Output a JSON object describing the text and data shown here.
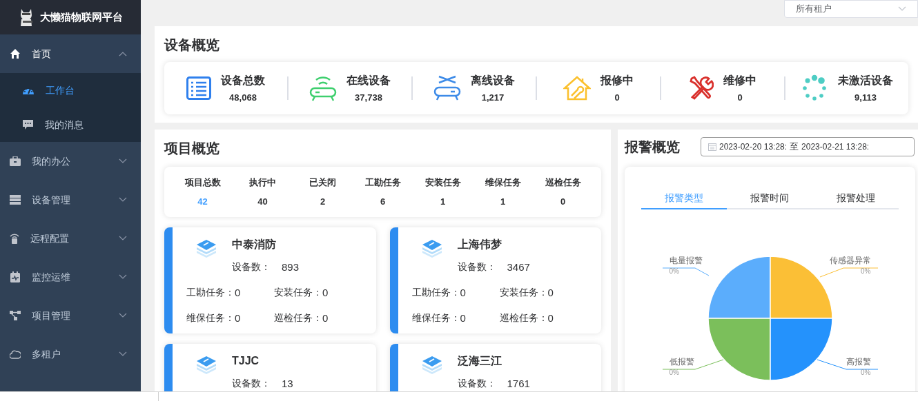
{
  "brand": {
    "title": "大懒猫物联网平台"
  },
  "sidebar": {
    "items": [
      {
        "label": "首页",
        "expanded": true,
        "children": [
          {
            "label": "工作台",
            "selected": true
          },
          {
            "label": "我的消息",
            "selected": false
          }
        ]
      },
      {
        "label": "我的办公",
        "expanded": false
      },
      {
        "label": "设备管理",
        "expanded": false
      },
      {
        "label": "远程配置",
        "expanded": false
      },
      {
        "label": "监控运维",
        "expanded": false
      },
      {
        "label": "项目管理",
        "expanded": false
      },
      {
        "label": "多租户",
        "expanded": false
      }
    ]
  },
  "tenant_select": {
    "value": "所有租户"
  },
  "device_overview": {
    "title": "设备概览",
    "stats": [
      {
        "label": "设备总数",
        "value": "48,068"
      },
      {
        "label": "在线设备",
        "value": "37,738"
      },
      {
        "label": "离线设备",
        "value": "1,217"
      },
      {
        "label": "报修中",
        "value": "0"
      },
      {
        "label": "维修中",
        "value": "0"
      },
      {
        "label": "未激活设备",
        "value": "9,113"
      }
    ]
  },
  "project_overview": {
    "title": "项目概览",
    "stats": [
      {
        "label": "项目总数",
        "value": "42",
        "highlight": true
      },
      {
        "label": "执行中",
        "value": "40",
        "highlight": false
      },
      {
        "label": "已关闭",
        "value": "2",
        "highlight": false
      },
      {
        "label": "工勘任务",
        "value": "6",
        "highlight": false
      },
      {
        "label": "安装任务",
        "value": "1",
        "highlight": false
      },
      {
        "label": "维保任务",
        "value": "1",
        "highlight": false
      },
      {
        "label": "巡检任务",
        "value": "0",
        "highlight": false
      }
    ],
    "projects": [
      {
        "name": "中泰消防",
        "device_label": "设备数：",
        "device_count": "893",
        "tasks": [
          {
            "label": "工勘任务：",
            "value": "0"
          },
          {
            "label": "安装任务：",
            "value": "0"
          },
          {
            "label": "维保任务：",
            "value": "0"
          },
          {
            "label": "巡检任务：",
            "value": "0"
          }
        ]
      },
      {
        "name": "上海伟梦",
        "device_label": "设备数：",
        "device_count": "3467",
        "tasks": [
          {
            "label": "工勘任务：",
            "value": "0"
          },
          {
            "label": "安装任务：",
            "value": "0"
          },
          {
            "label": "维保任务：",
            "value": "0"
          },
          {
            "label": "巡检任务：",
            "value": "0"
          }
        ]
      },
      {
        "name": "TJJC",
        "device_label": "设备数：",
        "device_count": "13"
      },
      {
        "name": "泛海三江",
        "device_label": "设备数：",
        "device_count": "1761"
      }
    ]
  },
  "alarm_overview": {
    "title": "报警概览",
    "date_range": {
      "start": "2023-02-20 13:28:",
      "separator": "至",
      "end": "2023-02-21 13:28:"
    },
    "tabs": [
      {
        "label": "报警类型",
        "selected": true
      },
      {
        "label": "报警时间",
        "selected": false
      },
      {
        "label": "报警处理",
        "selected": false
      }
    ],
    "pie": [
      {
        "name": "电量报警",
        "percent": "0%",
        "color": "#5badfc"
      },
      {
        "name": "传感器异常",
        "percent": "0%",
        "color": "#fbbf36"
      },
      {
        "name": "低报警",
        "percent": "0%",
        "color": "#7bbf5b"
      },
      {
        "name": "高报警",
        "percent": "0%",
        "color": "#2492fc"
      }
    ]
  }
}
